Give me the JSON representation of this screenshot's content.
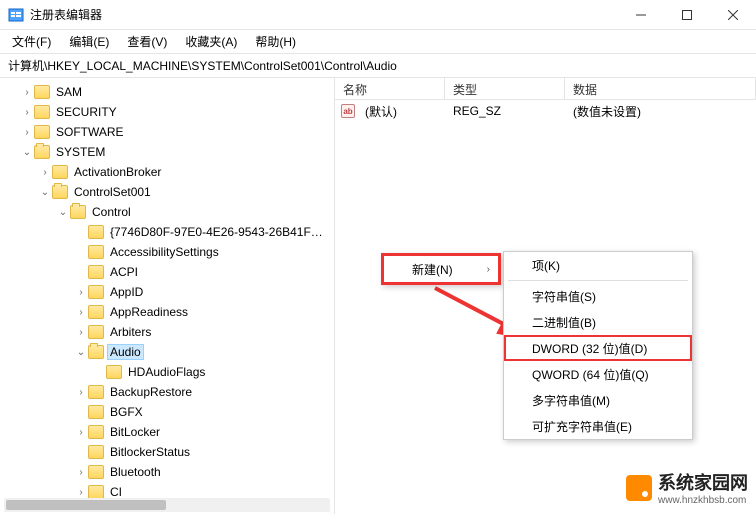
{
  "window": {
    "title": "注册表编辑器"
  },
  "menu": {
    "file": "文件(F)",
    "edit": "编辑(E)",
    "view": "查看(V)",
    "favorites": "收藏夹(A)",
    "help": "帮助(H)"
  },
  "address": {
    "path": "计算机\\HKEY_LOCAL_MACHINE\\SYSTEM\\ControlSet001\\Control\\Audio"
  },
  "tree": {
    "sam": "SAM",
    "security": "SECURITY",
    "software": "SOFTWARE",
    "system": "SYSTEM",
    "activationbroker": "ActivationBroker",
    "controlset001": "ControlSet001",
    "control": "Control",
    "guid": "{7746D80F-97E0-4E26-9543-26B41F…",
    "accessibility": "AccessibilitySettings",
    "acpi": "ACPI",
    "appid": "AppID",
    "appreadiness": "AppReadiness",
    "arbiters": "Arbiters",
    "audio": "Audio",
    "hdaudioflags": "HDAudioFlags",
    "backuprestore": "BackupRestore",
    "bgfx": "BGFX",
    "bitlocker": "BitLocker",
    "bitlockerstatus": "BitlockerStatus",
    "bluetooth": "Bluetooth",
    "ci": "CI"
  },
  "list": {
    "headers": {
      "name": "名称",
      "type": "类型",
      "data": "数据"
    },
    "rows": [
      {
        "name": "(默认)",
        "type": "REG_SZ",
        "data": "(数值未设置)"
      }
    ]
  },
  "context": {
    "new": "新建(N)",
    "sub": {
      "key": "项(K)",
      "string": "字符串值(S)",
      "binary": "二进制值(B)",
      "dword": "DWORD (32 位)值(D)",
      "qword": "QWORD (64 位)值(Q)",
      "multi": "多字符串值(M)",
      "expand": "可扩充字符串值(E)"
    }
  },
  "watermark": {
    "text": "系统家园网",
    "url": "www.hnzkhbsb.com"
  }
}
